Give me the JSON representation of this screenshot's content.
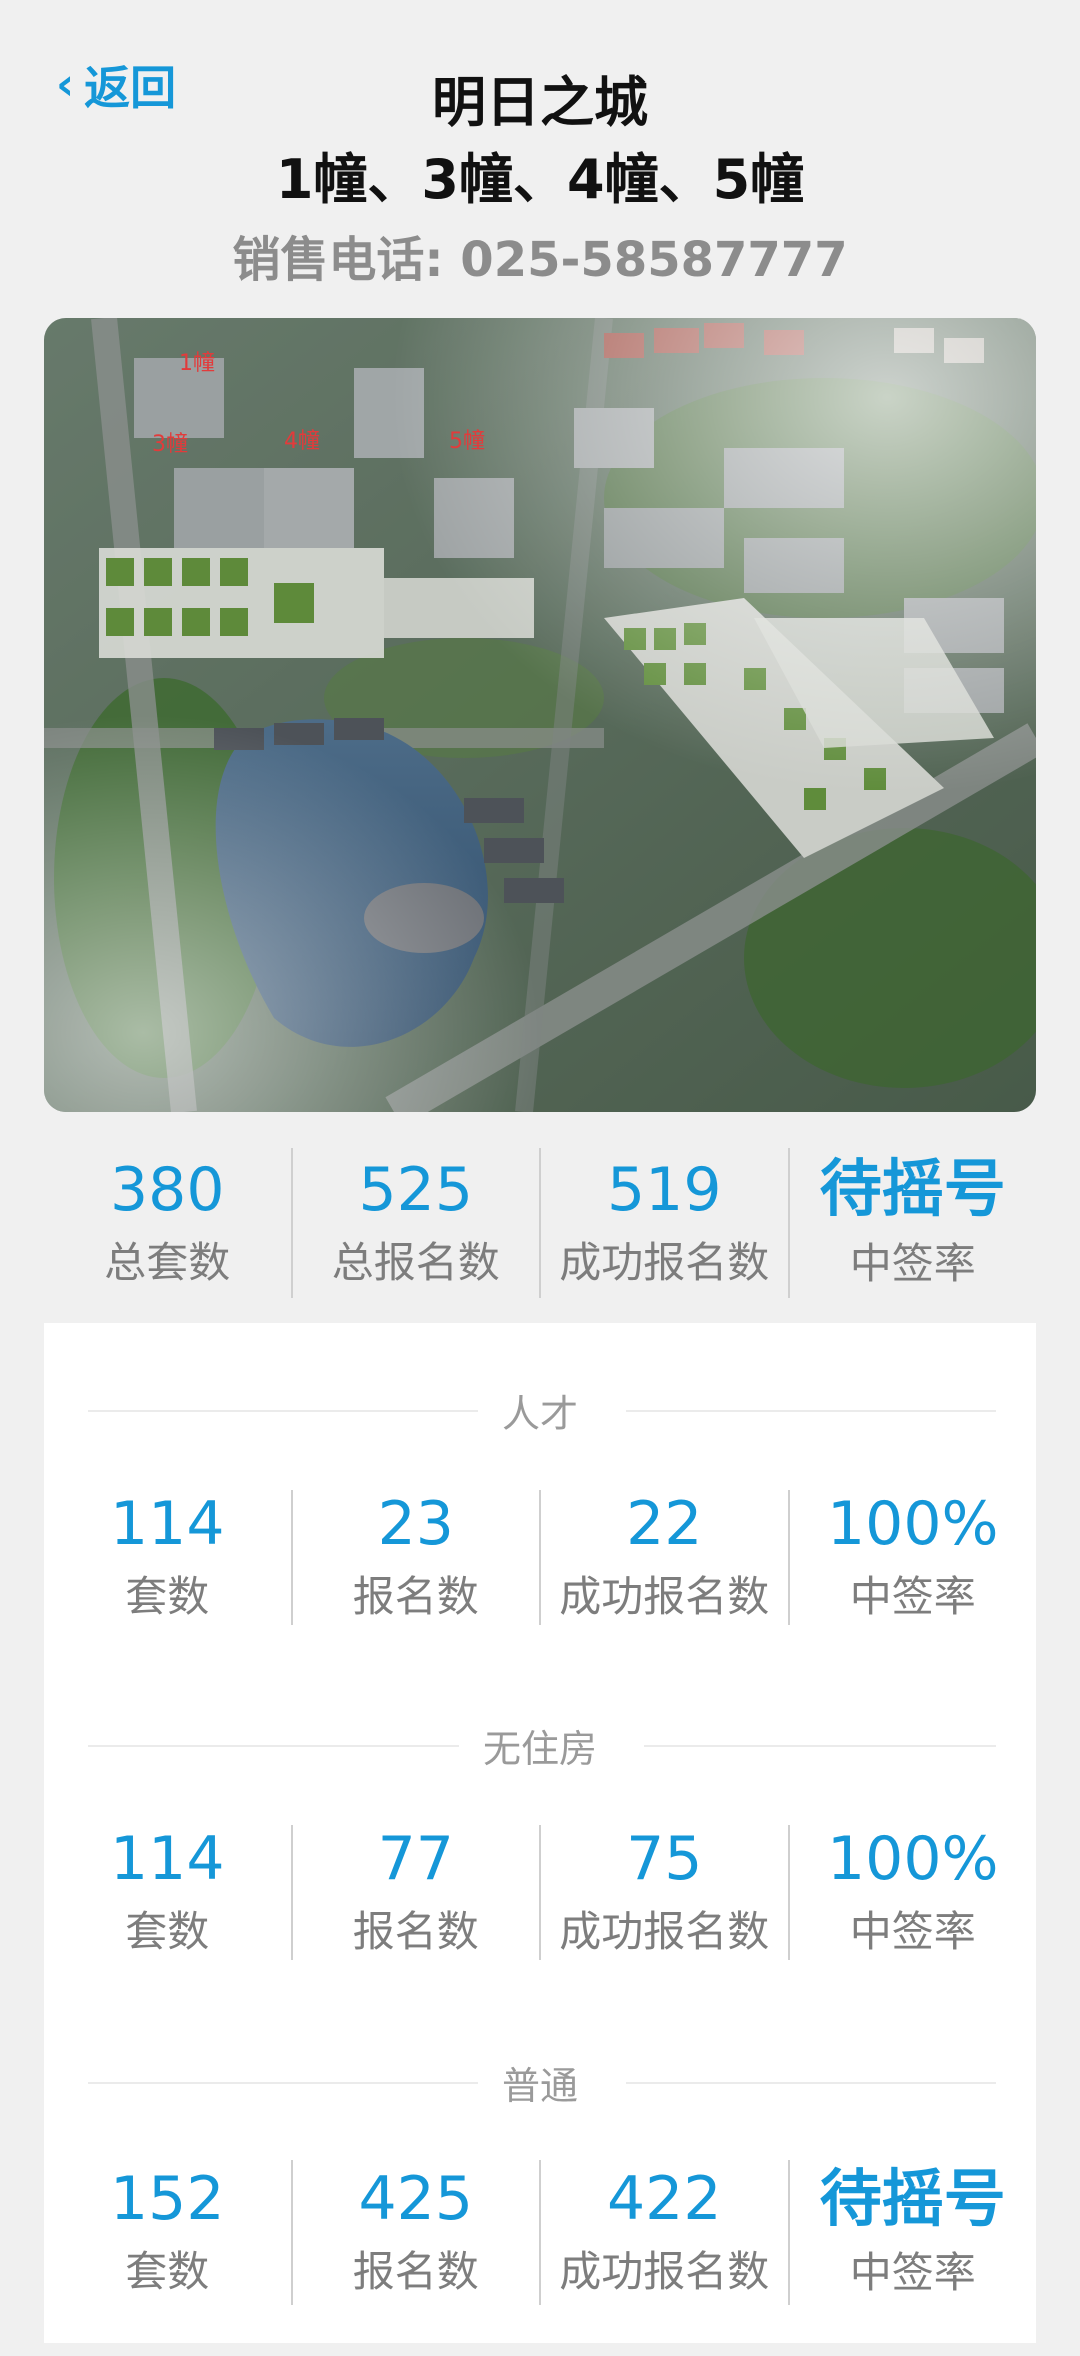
{
  "header": {
    "back_label": "返回",
    "title": "明日之城",
    "subtitle": "1幢、3幢、4幢、5幢",
    "phone": "销售电话: 025-58587777"
  },
  "hero": {
    "building_labels": [
      "1幢",
      "3幢",
      "4幢",
      "5幢"
    ]
  },
  "summary": [
    {
      "value": "380",
      "label": "总套数"
    },
    {
      "value": "525",
      "label": "总报名数"
    },
    {
      "value": "519",
      "label": "成功报名数"
    },
    {
      "value": "待摇号",
      "label": "中签率"
    }
  ],
  "sections": [
    {
      "title": "人才",
      "stats": [
        {
          "value": "114",
          "label": "套数"
        },
        {
          "value": "23",
          "label": "报名数"
        },
        {
          "value": "22",
          "label": "成功报名数"
        },
        {
          "value": "100%",
          "label": "中签率"
        }
      ]
    },
    {
      "title": "无住房",
      "stats": [
        {
          "value": "114",
          "label": "套数"
        },
        {
          "value": "77",
          "label": "报名数"
        },
        {
          "value": "75",
          "label": "成功报名数"
        },
        {
          "value": "100%",
          "label": "中签率"
        }
      ]
    },
    {
      "title": "普通",
      "stats": [
        {
          "value": "152",
          "label": "套数"
        },
        {
          "value": "425",
          "label": "报名数"
        },
        {
          "value": "422",
          "label": "成功报名数"
        },
        {
          "value": "待摇号",
          "label": "中签率"
        }
      ]
    }
  ],
  "colors": {
    "accent": "#1597d8",
    "label": "#7d7d7d",
    "background": "#f0f0f0",
    "panel": "#ffffff"
  }
}
